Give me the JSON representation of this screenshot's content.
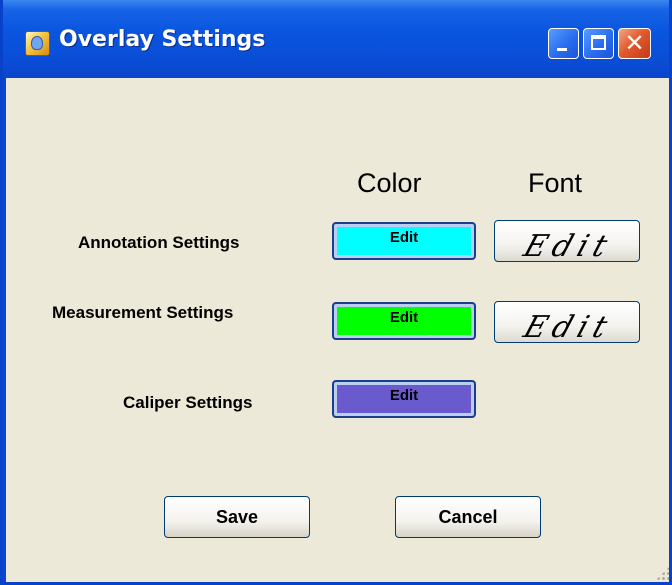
{
  "window": {
    "title": "Overlay Settings",
    "app_icon": "overlay-app-icon",
    "controls": {
      "minimize_icon": "minimize-icon",
      "maximize_icon": "maximize-icon",
      "close_glyph": "✕"
    }
  },
  "columns": {
    "color": "Color",
    "font": "Font"
  },
  "rows": [
    {
      "label": "Annotation Settings",
      "color_button": "Edit",
      "color": "#00ffff",
      "font_button": "Edit"
    },
    {
      "label": "Measurement Settings",
      "color_button": "Edit",
      "color": "#00ff00",
      "font_button": "Edit"
    },
    {
      "label": "Caliper Settings",
      "color_button": "Edit",
      "color": "#6a5acd"
    }
  ],
  "actions": {
    "save": "Save",
    "cancel": "Cancel"
  },
  "colors": {
    "titlebar": "#0a55df",
    "client_background": "#ece9d8",
    "close_button": "#e35a2c"
  }
}
